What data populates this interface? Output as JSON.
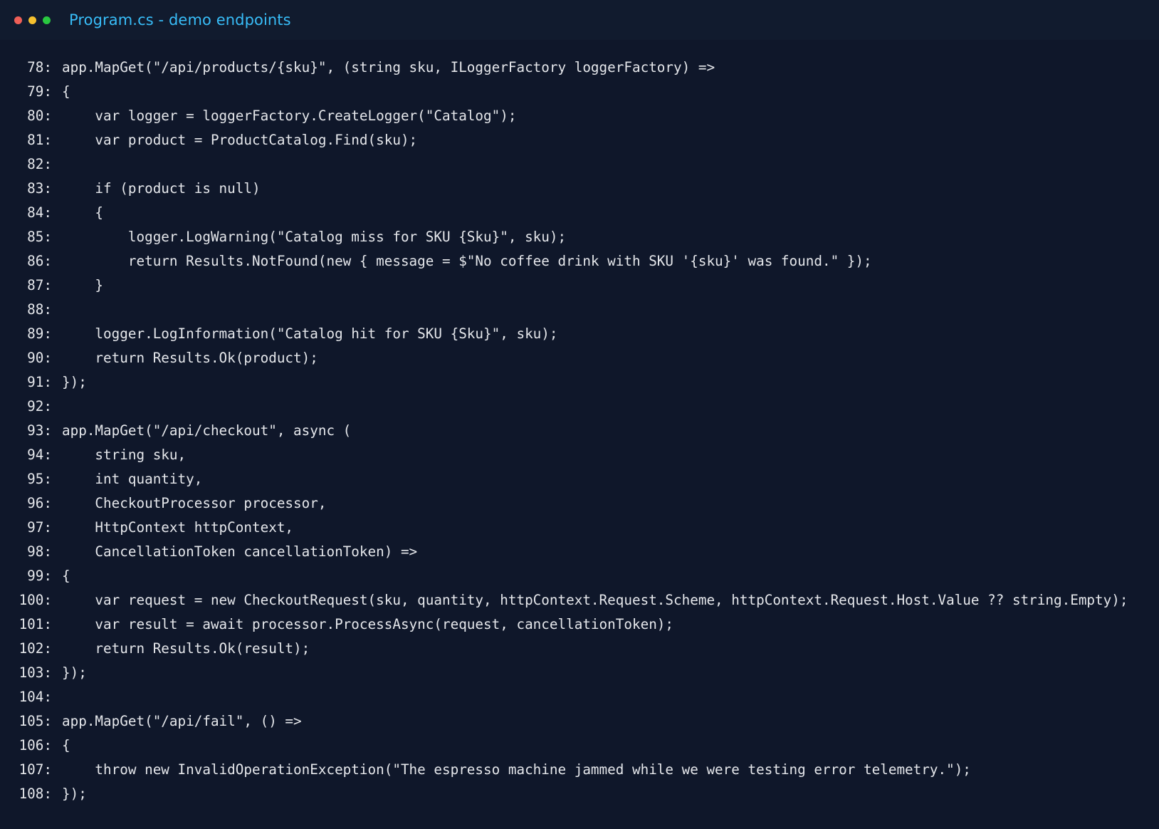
{
  "window": {
    "title": "Program.cs - demo endpoints",
    "buttons": [
      {
        "name": "close",
        "color": "#ef5f57"
      },
      {
        "name": "minimize",
        "color": "#f5c02e"
      },
      {
        "name": "maximize",
        "color": "#29c840"
      }
    ]
  },
  "code": {
    "lines": [
      {
        "num": "78:",
        "text": "app.MapGet(\"/api/products/{sku}\", (string sku, ILoggerFactory loggerFactory) =>"
      },
      {
        "num": "79:",
        "text": "{"
      },
      {
        "num": "80:",
        "text": "    var logger = loggerFactory.CreateLogger(\"Catalog\");"
      },
      {
        "num": "81:",
        "text": "    var product = ProductCatalog.Find(sku);"
      },
      {
        "num": "82:",
        "text": ""
      },
      {
        "num": "83:",
        "text": "    if (product is null)"
      },
      {
        "num": "84:",
        "text": "    {"
      },
      {
        "num": "85:",
        "text": "        logger.LogWarning(\"Catalog miss for SKU {Sku}\", sku);"
      },
      {
        "num": "86:",
        "text": "        return Results.NotFound(new { message = $\"No coffee drink with SKU '{sku}' was found.\" });"
      },
      {
        "num": "87:",
        "text": "    }"
      },
      {
        "num": "88:",
        "text": ""
      },
      {
        "num": "89:",
        "text": "    logger.LogInformation(\"Catalog hit for SKU {Sku}\", sku);"
      },
      {
        "num": "90:",
        "text": "    return Results.Ok(product);"
      },
      {
        "num": "91:",
        "text": "});"
      },
      {
        "num": "92:",
        "text": ""
      },
      {
        "num": "93:",
        "text": "app.MapGet(\"/api/checkout\", async ("
      },
      {
        "num": "94:",
        "text": "    string sku,"
      },
      {
        "num": "95:",
        "text": "    int quantity,"
      },
      {
        "num": "96:",
        "text": "    CheckoutProcessor processor,"
      },
      {
        "num": "97:",
        "text": "    HttpContext httpContext,"
      },
      {
        "num": "98:",
        "text": "    CancellationToken cancellationToken) =>"
      },
      {
        "num": "99:",
        "text": "{"
      },
      {
        "num": "100:",
        "text": "    var request = new CheckoutRequest(sku, quantity, httpContext.Request.Scheme, httpContext.Request.Host.Value ?? string.Empty);"
      },
      {
        "num": "101:",
        "text": "    var result = await processor.ProcessAsync(request, cancellationToken);"
      },
      {
        "num": "102:",
        "text": "    return Results.Ok(result);"
      },
      {
        "num": "103:",
        "text": "});"
      },
      {
        "num": "104:",
        "text": ""
      },
      {
        "num": "105:",
        "text": "app.MapGet(\"/api/fail\", () =>"
      },
      {
        "num": "106:",
        "text": "{"
      },
      {
        "num": "107:",
        "text": "    throw new InvalidOperationException(\"The espresso machine jammed while we were testing error telemetry.\");"
      },
      {
        "num": "108:",
        "text": "});"
      }
    ]
  }
}
